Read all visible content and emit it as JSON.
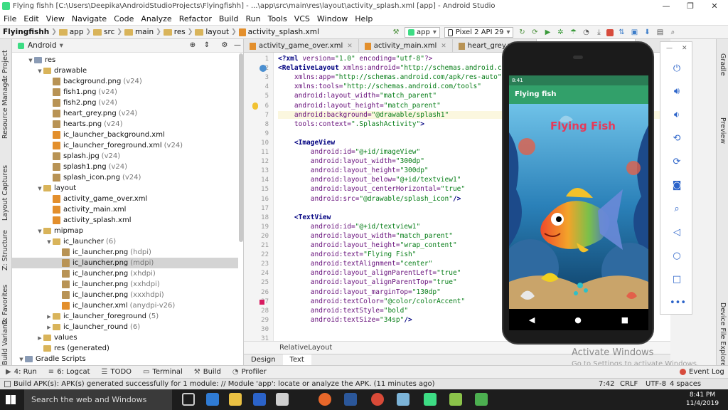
{
  "window": {
    "title": "Flying fishh [C:\\Users\\Deepika\\AndroidStudioProjects\\Flyingfishh] - ...\\app\\src\\main\\res\\layout\\activity_splash.xml [app] - Android Studio",
    "minimize": "—",
    "maximize": "❐",
    "close": "✕"
  },
  "menu": [
    "File",
    "Edit",
    "View",
    "Navigate",
    "Code",
    "Analyze",
    "Refactor",
    "Build",
    "Run",
    "Tools",
    "VCS",
    "Window",
    "Help"
  ],
  "navbar": {
    "crumbs": [
      "Flyingfishh",
      "app",
      "src",
      "main",
      "res",
      "layout",
      "activity_splash.xml"
    ],
    "run_config": "app",
    "device": "Pixel 2 API 29"
  },
  "left_stripe": [
    "1: Project",
    "Resource Manager",
    "Layout Captures",
    "Z: Structure",
    "2: Favorites",
    "Build Variants"
  ],
  "right_stripe": [
    "Gradle",
    "Preview",
    "Device File Explorer"
  ],
  "project": {
    "view_mode": "Android",
    "tree": [
      {
        "label": "res",
        "level": 1,
        "arrow": "▼",
        "kind": "res"
      },
      {
        "label": "drawable",
        "level": 2,
        "arrow": "▼",
        "kind": "dir"
      },
      {
        "label": "background.png",
        "suffix": "(v24)",
        "level": 3,
        "kind": "img"
      },
      {
        "label": "fish1.png",
        "suffix": "(v24)",
        "level": 3,
        "kind": "img"
      },
      {
        "label": "fish2.png",
        "suffix": "(v24)",
        "level": 3,
        "kind": "img"
      },
      {
        "label": "heart_grey.png",
        "suffix": "(v24)",
        "level": 3,
        "kind": "img"
      },
      {
        "label": "hearts.png",
        "suffix": "(v24)",
        "level": 3,
        "kind": "img"
      },
      {
        "label": "ic_launcher_background.xml",
        "level": 3,
        "kind": "xml"
      },
      {
        "label": "ic_launcher_foreground.xml",
        "suffix": "(v24)",
        "level": 3,
        "kind": "xml"
      },
      {
        "label": "splash.jpg",
        "suffix": "(v24)",
        "level": 3,
        "kind": "img"
      },
      {
        "label": "splash1.png",
        "suffix": "(v24)",
        "level": 3,
        "kind": "img"
      },
      {
        "label": "splash_icon.png",
        "suffix": "(v24)",
        "level": 3,
        "kind": "img"
      },
      {
        "label": "layout",
        "level": 2,
        "arrow": "▼",
        "kind": "dir"
      },
      {
        "label": "activity_game_over.xml",
        "level": 3,
        "kind": "xml"
      },
      {
        "label": "activity_main.xml",
        "level": 3,
        "kind": "xml"
      },
      {
        "label": "activity_splash.xml",
        "level": 3,
        "kind": "xml"
      },
      {
        "label": "mipmap",
        "level": 2,
        "arrow": "▼",
        "kind": "dir"
      },
      {
        "label": "ic_launcher",
        "suffix": "(6)",
        "level": 3,
        "arrow": "▼",
        "kind": "dir"
      },
      {
        "label": "ic_launcher.png",
        "suffix": "(hdpi)",
        "level": 4,
        "kind": "img"
      },
      {
        "label": "ic_launcher.png",
        "suffix": "(mdpi)",
        "level": 4,
        "kind": "img",
        "selected": true
      },
      {
        "label": "ic_launcher.png",
        "suffix": "(xhdpi)",
        "level": 4,
        "kind": "img"
      },
      {
        "label": "ic_launcher.png",
        "suffix": "(xxhdpi)",
        "level": 4,
        "kind": "img"
      },
      {
        "label": "ic_launcher.png",
        "suffix": "(xxxhdpi)",
        "level": 4,
        "kind": "img"
      },
      {
        "label": "ic_launcher.xml",
        "suffix": "(anydpi-v26)",
        "level": 4,
        "kind": "xml"
      },
      {
        "label": "ic_launcher_foreground",
        "suffix": "(5)",
        "level": 3,
        "arrow": "▶",
        "kind": "dir"
      },
      {
        "label": "ic_launcher_round",
        "suffix": "(6)",
        "level": 3,
        "arrow": "▶",
        "kind": "dir"
      },
      {
        "label": "values",
        "level": 2,
        "arrow": "▶",
        "kind": "dir"
      },
      {
        "label": "res (generated)",
        "level": 2,
        "kind": "dir"
      },
      {
        "label": "Gradle Scripts",
        "level": 0,
        "arrow": "▼",
        "kind": "res"
      }
    ]
  },
  "editor": {
    "tabs": [
      {
        "label": "activity_game_over.xml"
      },
      {
        "label": "activity_main.xml"
      },
      {
        "label": "heart_grey.png"
      },
      {
        "label": "activity_splash.xml",
        "active": true
      }
    ],
    "lines": [
      "<?xml version=\"1.0\" encoding=\"utf-8\"?>",
      "<RelativeLayout xmlns:android=\"http://schemas.android.com/apk/res/android\"",
      "    xmlns:app=\"http://schemas.android.com/apk/res-auto\"",
      "    xmlns:tools=\"http://schemas.android.com/tools\"",
      "    android:layout_width=\"match_parent\"",
      "    android:layout_height=\"match_parent\"",
      "    android:background=\"@drawable/splash1\"",
      "    tools:context=\".SplashActivity\">",
      "",
      "    <ImageView",
      "        android:id=\"@+id/imageView\"",
      "        android:layout_width=\"300dp\"",
      "        android:layout_height=\"300dp\"",
      "        android:layout_below=\"@+id/textview1\"",
      "        android:layout_centerHorizontal=\"true\"",
      "        android:src=\"@drawable/splash_icon\"/>",
      "",
      "    <TextView",
      "        android:id=\"@+id/textview1\"",
      "        android:layout_width=\"match_parent\"",
      "        android:layout_height=\"wrap_content\"",
      "        android:text=\"Flying Fish\"",
      "        android:textAlignment=\"center\"",
      "        android:layout_alignParentLeft=\"true\"",
      "        android:layout_alignParentTop=\"true\"",
      "        android:layout_marginTop=\"130dp\"",
      "        android:textColor=\"@color/colorAccent\"",
      "        android:textStyle=\"bold\"",
      "        android:textSize=\"34sp\"/>",
      "",
      ""
    ],
    "breadcrumb": "RelativeLayout",
    "bottom_tabs": [
      "Design",
      "Text"
    ]
  },
  "emulator": {
    "status_time": "8:41",
    "app_title": "Flying fish",
    "splash_text": "Flying Fish",
    "panel_close": "✕",
    "panel_min": "—"
  },
  "toolwindows": [
    "4: Run",
    "6: Logcat",
    "TODO",
    "Terminal",
    "Build",
    "Profiler"
  ],
  "event_log": "Event Log",
  "status": {
    "message": "Build APK(s): APK(s) generated successfully for 1 module: // Module 'app': locate or analyze the APK. (11 minutes ago)",
    "position": "7:42",
    "line_sep": "CRLF",
    "encoding": "UTF-8",
    "indent": "4 spaces"
  },
  "watermark": {
    "line1": "Activate Windows",
    "line2": "Go to Settings to activate Windows."
  },
  "taskbar": {
    "search": "Search the web and Windows",
    "time": "8:41 PM",
    "date": "11/4/2019"
  }
}
